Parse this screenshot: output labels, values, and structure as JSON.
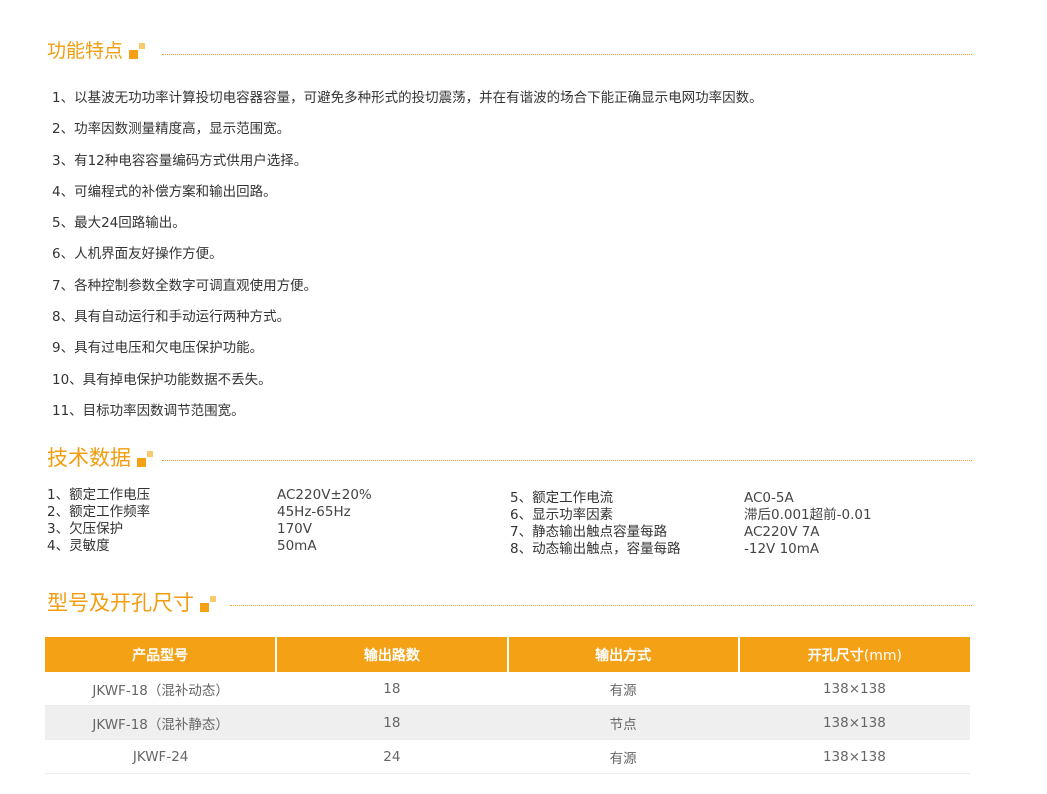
{
  "sections": {
    "features": {
      "title": "功能特点"
    },
    "specs": {
      "title": "技术数据"
    },
    "models": {
      "title": "型号及开孔尺寸"
    }
  },
  "features": [
    "1、以基波无功功率计算投切电容器容量，可避免多种形式的投切震荡，并在有谐波的场合下能正确显示电网功率因数。",
    "2、功率因数测量精度高，显示范围宽。",
    "3、有12种电容容量编码方式供用户选择。",
    "4、可编程式的补偿方案和输出回路。",
    "5、最大24回路输出。",
    "6、人机界面友好操作方便。",
    "7、各种控制参数全数字可调直观使用方便。",
    "8、具有自动运行和手动运行两种方式。",
    "9、具有过电压和欠电压保护功能。",
    "10、具有掉电保护功能数据不丢失。",
    "11、目标功率因数调节范围宽。"
  ],
  "specs": {
    "left": [
      {
        "label": "1、额定工作电压",
        "value": "AC220V±20%"
      },
      {
        "label": "2、额定工作频率",
        "value": "45Hz-65Hz"
      },
      {
        "label": "3、欠压保护",
        "value": "170V"
      },
      {
        "label": "4、灵敏度",
        "value": "50mA"
      }
    ],
    "right": [
      {
        "label": "5、额定工作电流",
        "value": "AC0-5A"
      },
      {
        "label": "6、显示功率因素",
        "value": "滞后0.001超前-0.01"
      },
      {
        "label": "7、静态输出触点容量每路",
        "value": "AC220V  7A"
      },
      {
        "label": "8、动态输出触点，容量每路",
        "value": "-12V  10mA"
      }
    ]
  },
  "table": {
    "headers": [
      "产品型号",
      "输出路数",
      "输出方式",
      "开孔尺寸"
    ],
    "header_unit": "(mm)",
    "rows": [
      [
        "JKWF-18（混补动态）",
        "18",
        "有源",
        "138×138"
      ],
      [
        "JKWF-18（混补静态）",
        "18",
        "节点",
        "138×138"
      ],
      [
        "JKWF-24",
        "24",
        "有源",
        "138×138"
      ]
    ]
  },
  "colors": {
    "accent": "#f4a116",
    "title": "#f29d0f",
    "row_alt": "#efefef"
  }
}
